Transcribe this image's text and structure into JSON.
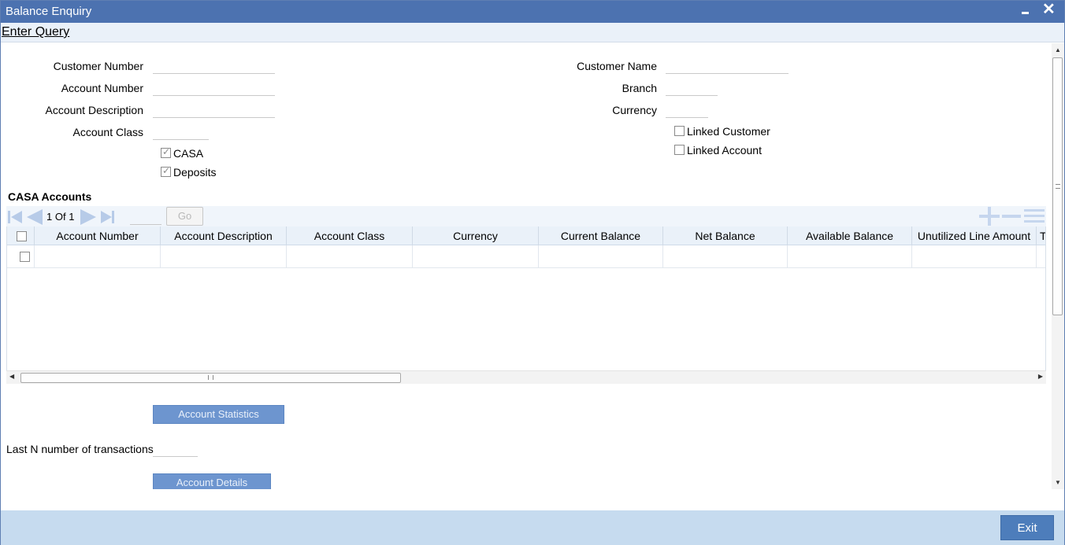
{
  "window": {
    "title": "Balance Enquiry",
    "minimize_icon": "minimize-icon",
    "close_icon": "close-icon",
    "close_glyph": "✕"
  },
  "toolbar": {
    "enter_query": "Enter Query"
  },
  "form": {
    "customer_number": {
      "label": "Customer Number",
      "value": ""
    },
    "account_number": {
      "label": "Account Number",
      "value": ""
    },
    "account_description": {
      "label": "Account Description",
      "value": ""
    },
    "account_class": {
      "label": "Account Class",
      "value": ""
    },
    "customer_name": {
      "label": "Customer Name",
      "value": ""
    },
    "branch": {
      "label": "Branch",
      "value": ""
    },
    "currency": {
      "label": "Currency",
      "value": ""
    },
    "casa": {
      "label": "CASA",
      "checked": true
    },
    "deposits": {
      "label": "Deposits",
      "checked": true
    },
    "linked_customer": {
      "label": "Linked Customer",
      "checked": false
    },
    "linked_account": {
      "label": "Linked Account",
      "checked": false
    }
  },
  "casa_accounts": {
    "section_title": "CASA Accounts",
    "pagination": {
      "current": "1",
      "of_label": "Of",
      "total": "1",
      "page_input": "",
      "go_label": "Go"
    },
    "columns": [
      "Account Number",
      "Account Description",
      "Account Class",
      "Currency",
      "Current Balance",
      "Net Balance",
      "Available Balance",
      "Unutilized Line Amount",
      "Te"
    ],
    "rows": [
      {
        "selected": false,
        "cells": [
          "",
          "",
          "",
          "",
          "",
          "",
          "",
          "",
          ""
        ]
      }
    ]
  },
  "actions": {
    "account_statistics": "Account Statistics",
    "last_n_label": "Last N number of transactions",
    "last_n_value": "",
    "account_details": "Account Details"
  },
  "footer": {
    "exit": "Exit"
  },
  "colors": {
    "titlebar": "#4c72b0",
    "button": "#6d95cf",
    "footer": "#c6dbef",
    "exit_button": "#4d7dbb"
  }
}
